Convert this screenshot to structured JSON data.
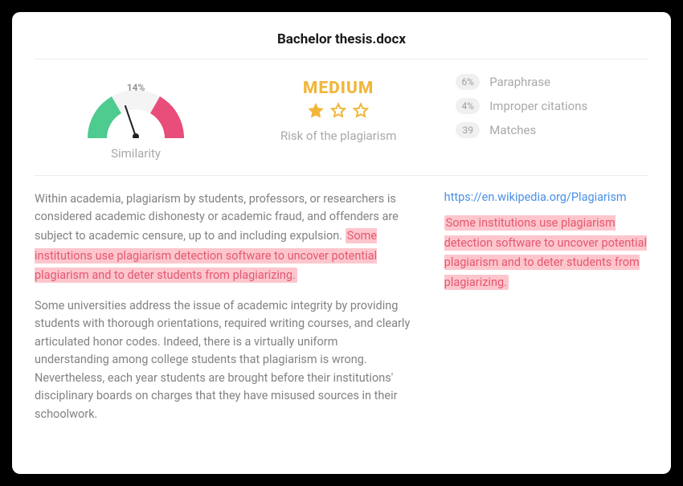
{
  "title": "Bachelor thesis.docx",
  "similarity": {
    "percent": "14%",
    "label": "Similarity"
  },
  "risk": {
    "level": "MEDIUM",
    "label": "Risk of the plagiarism",
    "stars_filled": 1,
    "stars_total": 3
  },
  "stats": {
    "paraphrase": {
      "value": "6%",
      "label": "Paraphrase"
    },
    "citations": {
      "value": "4%",
      "label": "Improper citations"
    },
    "matches": {
      "value": "39",
      "label": "Matches"
    }
  },
  "doc": {
    "p1_pre": "Within academia, plagiarism by students, professors, or researchers is considered academic dishonesty or academic fraud, and offenders are subject to academic censure, up to and including expulsion.  ",
    "p1_hl": "Some institutions use plagiarism detection software to uncover potential plagiarism and to deter students from plagiarizing.",
    "p2": "Some universities address the issue of academic integrity by providing students with thorough orientations, required writing courses, and clearly articulated honor codes. Indeed, there is a virtually uniform understanding among college students that plagiarism is wrong. Nevertheless, each year students are brought before their institutions' disciplinary boards on charges that they have misused sources in their schoolwork."
  },
  "match": {
    "url": "https://en.wikipedia.org/Plagiarism",
    "excerpt": "Some institutions use plagiarism detection software to uncover potential plagiarism and to deter students from plagiarizing."
  }
}
